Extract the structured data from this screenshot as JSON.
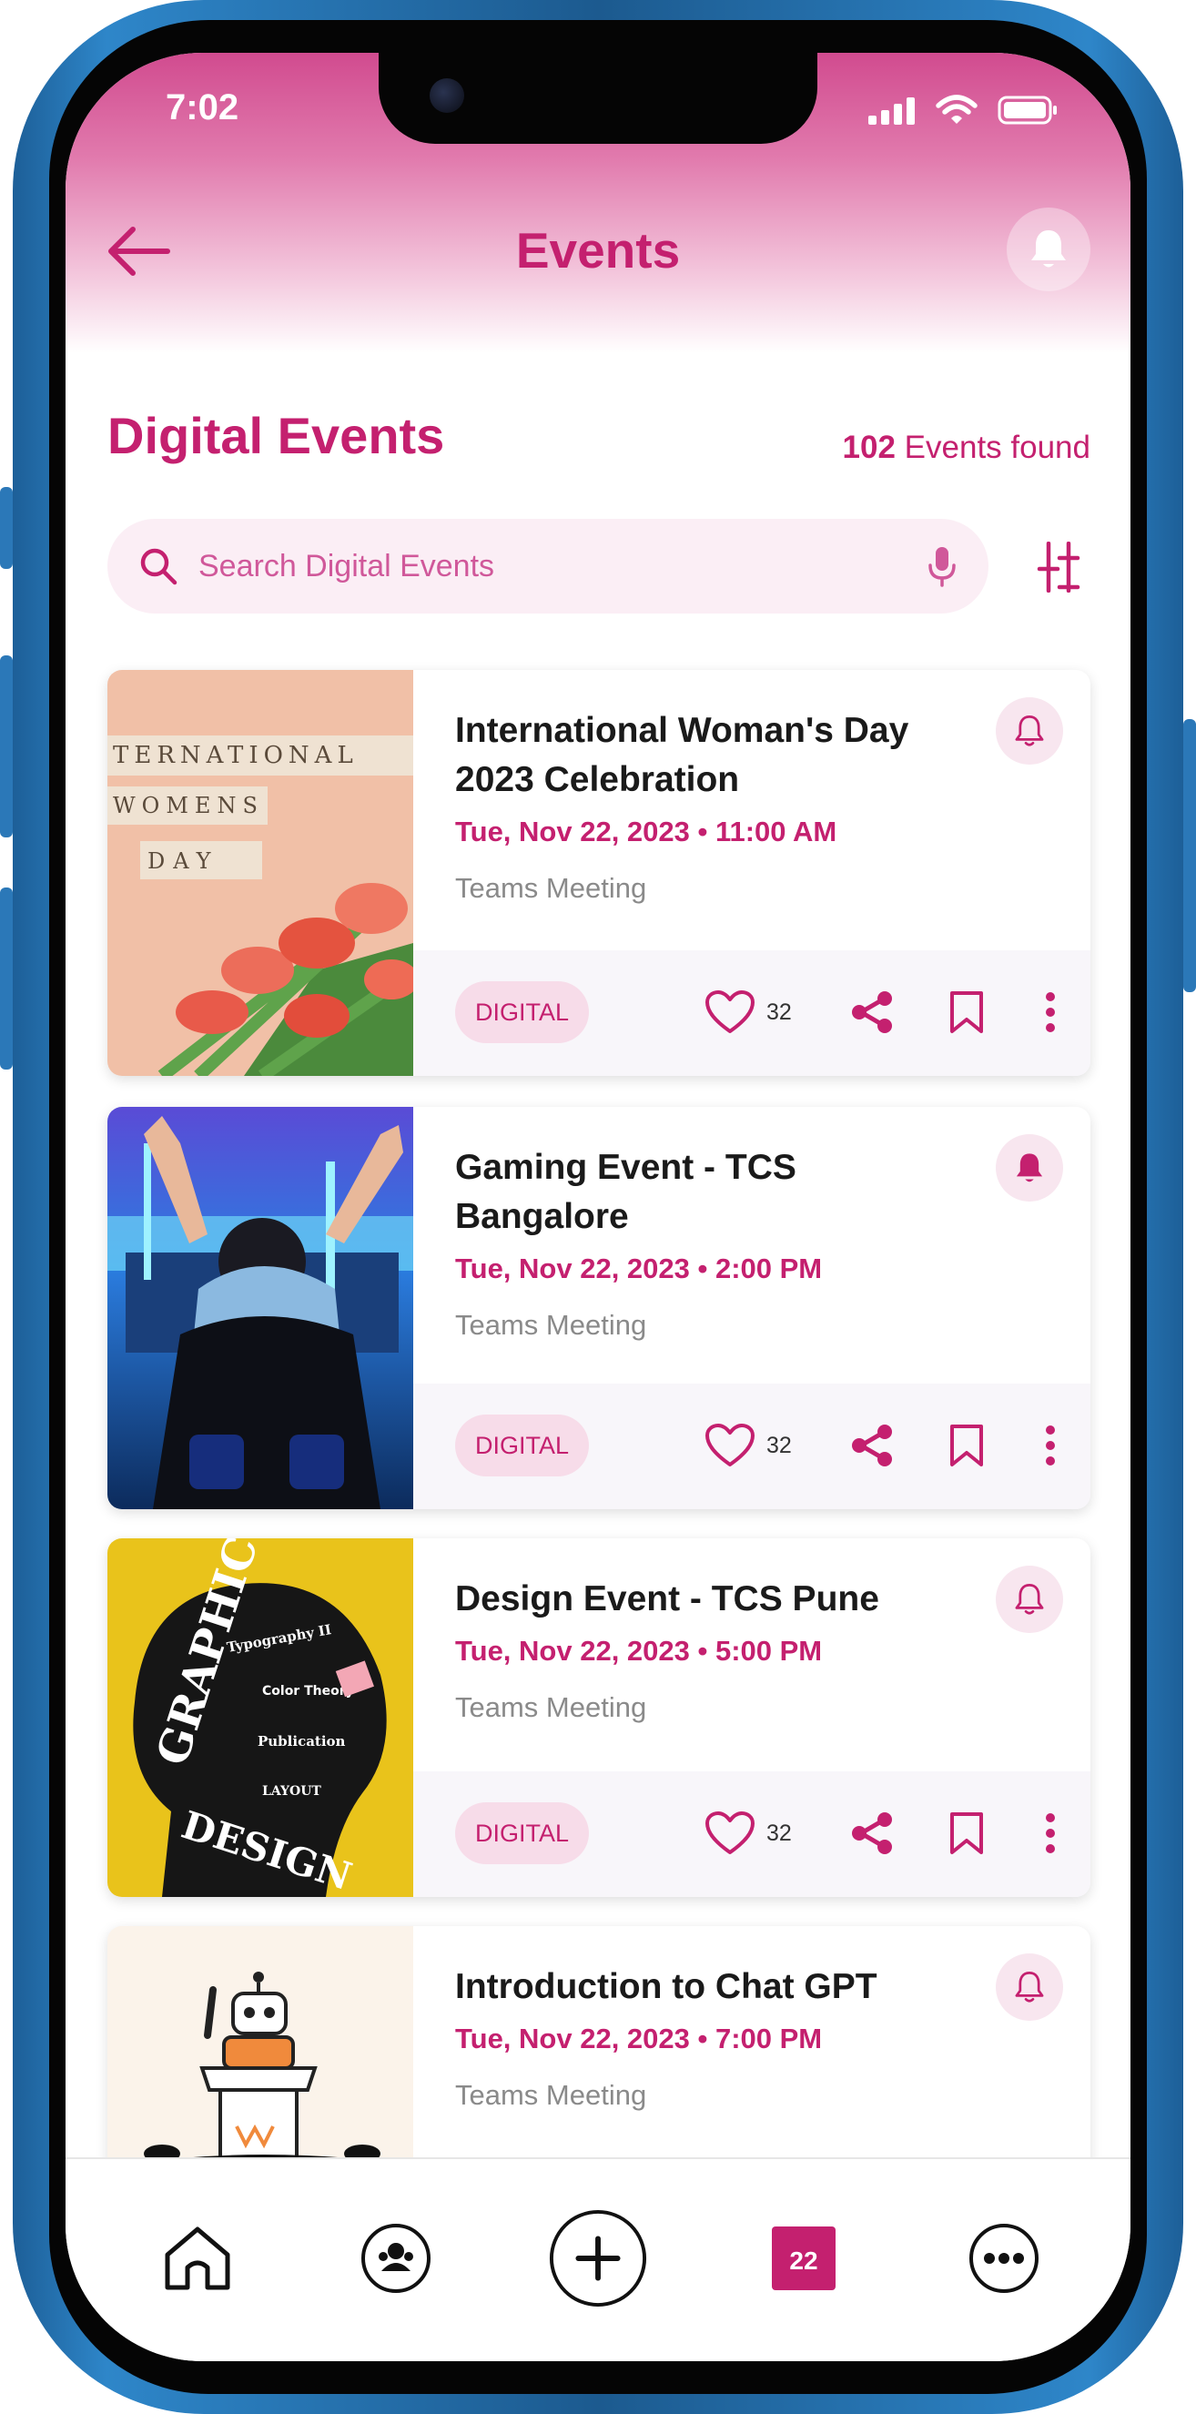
{
  "status_bar": {
    "time": "7:02"
  },
  "header": {
    "title": "Events"
  },
  "section": {
    "title": "Digital Events",
    "count_number": "102",
    "count_text": " Events found"
  },
  "search": {
    "placeholder": "Search Digital Events"
  },
  "colors": {
    "accent": "#c4206f",
    "tag_bg": "#f7dce9",
    "card_footer_bg": "#f8f6fa"
  },
  "events": [
    {
      "title": "International Woman's Day 2023 Celebration",
      "date": "Tue, Nov 22, 2023 • 11:00 AM",
      "venue": "Teams Meeting",
      "tag": "DIGITAL",
      "likes": "32",
      "reminder_on": false
    },
    {
      "title": "Gaming Event - TCS Bangalore",
      "date": "Tue, Nov 22, 2023 • 2:00 PM",
      "venue": "Teams Meeting",
      "tag": "DIGITAL",
      "likes": "32",
      "reminder_on": true
    },
    {
      "title": "Design Event - TCS Pune",
      "date": "Tue, Nov 22, 2023 • 5:00 PM",
      "venue": "Teams Meeting",
      "tag": "DIGITAL",
      "likes": "32",
      "reminder_on": false
    },
    {
      "title": "Introduction to Chat GPT",
      "date": "Tue, Nov 22, 2023 • 7:00 PM",
      "venue": "Teams Meeting",
      "reminder_on": false
    }
  ],
  "thumb_text": {
    "womens_day": [
      "TERNATIONAL",
      "WOMENS",
      "DAY"
    ],
    "design": [
      "GRAPHIC",
      "DESIGN",
      "Typography II",
      "Color Theory",
      "Publication",
      "LAYOUT"
    ]
  },
  "bottom_nav": {
    "items": [
      "home-icon",
      "community-icon",
      "add-icon",
      "calendar-icon",
      "more-icon"
    ],
    "calendar_day": "22"
  }
}
